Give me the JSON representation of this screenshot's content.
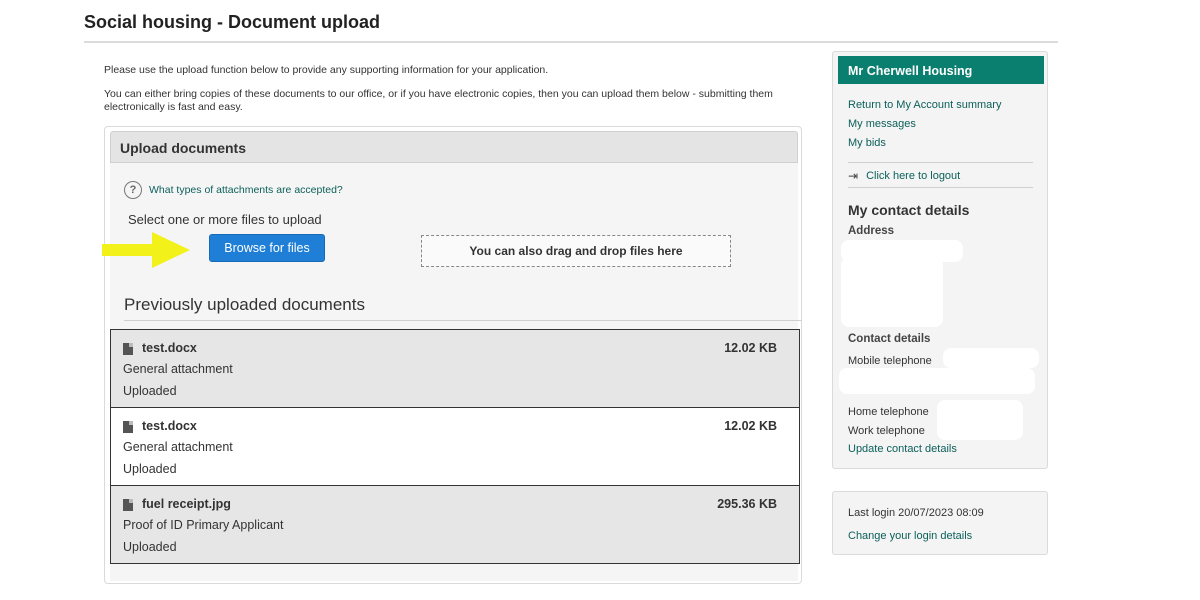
{
  "page": {
    "title": "Social housing - Document upload"
  },
  "intro": {
    "line1": "Please use the upload function below to provide any supporting information for your application.",
    "line2": "You can either bring copies of these documents to our office, or if you have electronic copies, then you can upload them below - submitting them electronically is fast and easy."
  },
  "upload": {
    "header": "Upload documents",
    "help_link": "What types of attachments are accepted?",
    "select_label": "Select one or more files to upload",
    "browse_button": "Browse for files",
    "drop_zone": "You can also drag and drop files here"
  },
  "previous": {
    "title": "Previously uploaded documents",
    "documents": [
      {
        "name": "test.docx",
        "size": "12.02 KB",
        "type": "General attachment",
        "status": "Uploaded"
      },
      {
        "name": "test.docx",
        "size": "12.02 KB",
        "type": "General attachment",
        "status": "Uploaded"
      },
      {
        "name": "fuel receipt.jpg",
        "size": "295.36 KB",
        "type": "Proof of ID Primary Applicant",
        "status": "Uploaded"
      }
    ]
  },
  "sidebar": {
    "header": "Mr Cherwell Housing",
    "links": [
      "Return to My Account summary",
      "My messages",
      "My bids"
    ],
    "logout": "Click here to logout",
    "contact_heading": "My contact details",
    "address_label": "Address",
    "contact_label": "Contact details",
    "mobile": "Mobile telephone",
    "home": "Home telephone",
    "work": "Work telephone",
    "update_link": "Update contact details"
  },
  "login": {
    "last_login": "Last login 20/07/2023 08:09",
    "change_link": "Change your login details"
  },
  "colors": {
    "accent": "#0a7f6f",
    "button": "#1f7fd6",
    "arrow": "#f2f21a"
  }
}
